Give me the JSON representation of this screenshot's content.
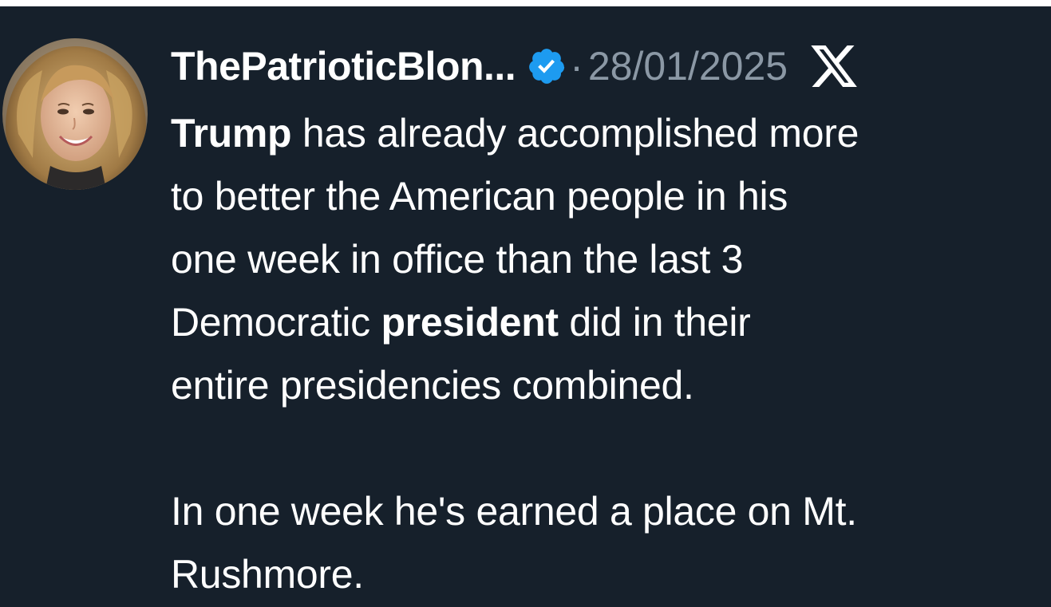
{
  "tweet": {
    "author_name": "ThePatrioticBlon...",
    "separator": "·",
    "date": "28/01/2025",
    "verified_icon": "verified-badge-icon",
    "platform_icon": "x-logo-icon",
    "colors": {
      "background": "#16202b",
      "text": "#ffffff",
      "muted": "#8b98a5",
      "verified": "#1d9bf0"
    },
    "body": {
      "line1_bold": "Trump",
      "line1_rest": " has already accomplished more",
      "line2": "to better the American people in his",
      "line3": "one week in office than the last 3",
      "line4_pre": "Democratic ",
      "line4_bold": "president",
      "line4_post": " did in their",
      "line5": "entire presidencies combined.",
      "line7": "In one week he's earned a place on Mt.",
      "line8": "Rushmore."
    }
  }
}
